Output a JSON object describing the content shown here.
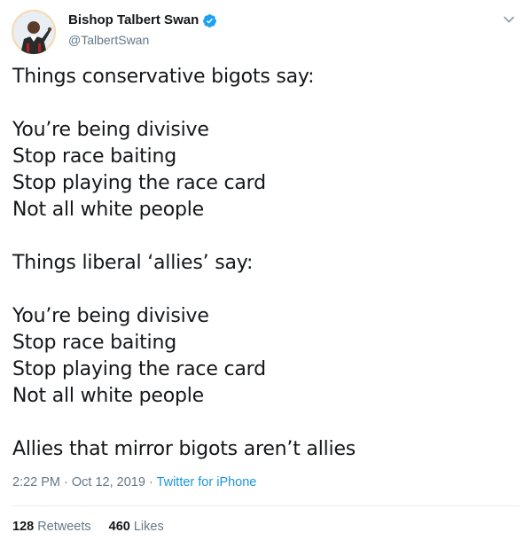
{
  "author": {
    "display_name": "Bishop Talbert Swan",
    "handle": "@TalbertSwan",
    "verified": true
  },
  "tweet": {
    "lines": [
      "Things conservative bigots say:",
      "",
      "You’re being divisive",
      "Stop race baiting",
      "Stop playing the race card",
      "Not all white people",
      "",
      "Things liberal ‘allies’ say:",
      "",
      "You’re being divisive",
      "Stop race baiting",
      "Stop playing the race card",
      "Not all white people",
      "",
      "Allies that mirror bigots aren’t allies"
    ]
  },
  "meta": {
    "timestamp": "2:22 PM · Oct 12, 2019",
    "separator": " · ",
    "source": "Twitter for iPhone"
  },
  "stats": {
    "retweets_count": "128",
    "retweets_label": "Retweets",
    "likes_count": "460",
    "likes_label": "Likes"
  },
  "colors": {
    "text": "#14171a",
    "secondary": "#657786",
    "link": "#1b95e0",
    "verified": "#1da1f2",
    "divider": "#e6ecf0"
  },
  "icons": {
    "verified": "verified-badge-icon",
    "caret": "chevron-down-icon"
  }
}
